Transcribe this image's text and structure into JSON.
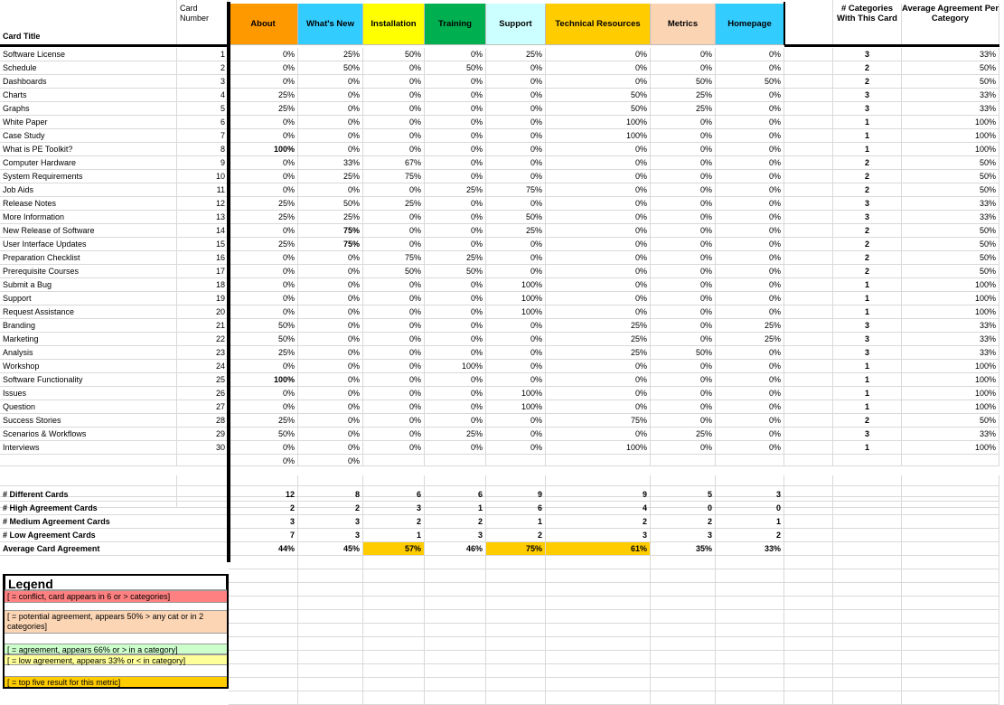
{
  "header": {
    "card_number": "Card\nNumber",
    "card_title": "Card Title",
    "categories": [
      {
        "label": "About",
        "color": "#ff9900"
      },
      {
        "label": "What's New",
        "color": "#33ccff"
      },
      {
        "label": "Installation",
        "color": "#ffff00"
      },
      {
        "label": "Training",
        "color": "#00b050"
      },
      {
        "label": "Support",
        "color": "#ccffff"
      },
      {
        "label": "Technical Resources",
        "color": "#ffcc00"
      },
      {
        "label": "Metrics",
        "color": "#fbd4b4"
      },
      {
        "label": "Homepage",
        "color": "#33ccff"
      }
    ],
    "num_categories": "# Categories With This Card",
    "avg_agreement": "Average Agreement Per Category"
  },
  "rows": [
    {
      "title": "Software License",
      "num": "1",
      "vals": [
        "0%",
        "25%",
        "50%",
        "0%",
        "25%",
        "0%",
        "0%",
        "0%"
      ],
      "cats": "3",
      "avg": "33%"
    },
    {
      "title": "Schedule",
      "num": "2",
      "vals": [
        "0%",
        "50%",
        "0%",
        "50%",
        "0%",
        "0%",
        "0%",
        "0%"
      ],
      "cats": "2",
      "avg": "50%"
    },
    {
      "title": "Dashboards",
      "num": "3",
      "vals": [
        "0%",
        "0%",
        "0%",
        "0%",
        "0%",
        "0%",
        "50%",
        "50%"
      ],
      "cats": "2",
      "avg": "50%"
    },
    {
      "title": "Charts",
      "num": "4",
      "vals": [
        "25%",
        "0%",
        "0%",
        "0%",
        "0%",
        "50%",
        "25%",
        "0%"
      ],
      "cats": "3",
      "avg": "33%"
    },
    {
      "title": "Graphs",
      "num": "5",
      "vals": [
        "25%",
        "0%",
        "0%",
        "0%",
        "0%",
        "50%",
        "25%",
        "0%"
      ],
      "cats": "3",
      "avg": "33%"
    },
    {
      "title": "White Paper",
      "num": "6",
      "vals": [
        "0%",
        "0%",
        "0%",
        "0%",
        "0%",
        "100%",
        "0%",
        "0%"
      ],
      "cats": "1",
      "avg": "100%"
    },
    {
      "title": "Case Study",
      "num": "7",
      "vals": [
        "0%",
        "0%",
        "0%",
        "0%",
        "0%",
        "100%",
        "0%",
        "0%"
      ],
      "cats": "1",
      "avg": "100%"
    },
    {
      "title": "What is PE Toolkit?",
      "num": "8",
      "vals": [
        "100%",
        "0%",
        "0%",
        "0%",
        "0%",
        "0%",
        "0%",
        "0%"
      ],
      "cats": "1",
      "avg": "100%"
    },
    {
      "title": "Computer Hardware",
      "num": "9",
      "vals": [
        "0%",
        "33%",
        "67%",
        "0%",
        "0%",
        "0%",
        "0%",
        "0%"
      ],
      "cats": "2",
      "avg": "50%"
    },
    {
      "title": "System Requirements",
      "num": "10",
      "vals": [
        "0%",
        "25%",
        "75%",
        "0%",
        "0%",
        "0%",
        "0%",
        "0%"
      ],
      "cats": "2",
      "avg": "50%"
    },
    {
      "title": "Job Aids",
      "num": "11",
      "vals": [
        "0%",
        "0%",
        "0%",
        "25%",
        "75%",
        "0%",
        "0%",
        "0%"
      ],
      "cats": "2",
      "avg": "50%"
    },
    {
      "title": "Release Notes",
      "num": "12",
      "vals": [
        "25%",
        "50%",
        "25%",
        "0%",
        "0%",
        "0%",
        "0%",
        "0%"
      ],
      "cats": "3",
      "avg": "33%"
    },
    {
      "title": "More Information",
      "num": "13",
      "vals": [
        "25%",
        "25%",
        "0%",
        "0%",
        "50%",
        "0%",
        "0%",
        "0%"
      ],
      "cats": "3",
      "avg": "33%"
    },
    {
      "title": "New Release of Software",
      "num": "14",
      "vals": [
        "0%",
        "75%",
        "0%",
        "0%",
        "25%",
        "0%",
        "0%",
        "0%"
      ],
      "cats": "2",
      "avg": "50%"
    },
    {
      "title": "User Interface Updates",
      "num": "15",
      "vals": [
        "25%",
        "75%",
        "0%",
        "0%",
        "0%",
        "0%",
        "0%",
        "0%"
      ],
      "cats": "2",
      "avg": "50%"
    },
    {
      "title": "Preparation Checklist",
      "num": "16",
      "vals": [
        "0%",
        "0%",
        "75%",
        "25%",
        "0%",
        "0%",
        "0%",
        "0%"
      ],
      "cats": "2",
      "avg": "50%"
    },
    {
      "title": "Prerequisite Courses",
      "num": "17",
      "vals": [
        "0%",
        "0%",
        "50%",
        "50%",
        "0%",
        "0%",
        "0%",
        "0%"
      ],
      "cats": "2",
      "avg": "50%"
    },
    {
      "title": "Submit a Bug",
      "num": "18",
      "vals": [
        "0%",
        "0%",
        "0%",
        "0%",
        "100%",
        "0%",
        "0%",
        "0%"
      ],
      "cats": "1",
      "avg": "100%"
    },
    {
      "title": "Support",
      "num": "19",
      "vals": [
        "0%",
        "0%",
        "0%",
        "0%",
        "100%",
        "0%",
        "0%",
        "0%"
      ],
      "cats": "1",
      "avg": "100%"
    },
    {
      "title": "Request Assistance",
      "num": "20",
      "vals": [
        "0%",
        "0%",
        "0%",
        "0%",
        "100%",
        "0%",
        "0%",
        "0%"
      ],
      "cats": "1",
      "avg": "100%"
    },
    {
      "title": "Branding",
      "num": "21",
      "vals": [
        "50%",
        "0%",
        "0%",
        "0%",
        "0%",
        "25%",
        "0%",
        "25%"
      ],
      "cats": "3",
      "avg": "33%"
    },
    {
      "title": "Marketing",
      "num": "22",
      "vals": [
        "50%",
        "0%",
        "0%",
        "0%",
        "0%",
        "25%",
        "0%",
        "25%"
      ],
      "cats": "3",
      "avg": "33%"
    },
    {
      "title": "Analysis",
      "num": "23",
      "vals": [
        "25%",
        "0%",
        "0%",
        "0%",
        "0%",
        "25%",
        "50%",
        "0%"
      ],
      "cats": "3",
      "avg": "33%"
    },
    {
      "title": "Workshop",
      "num": "24",
      "vals": [
        "0%",
        "0%",
        "0%",
        "100%",
        "0%",
        "0%",
        "0%",
        "0%"
      ],
      "cats": "1",
      "avg": "100%"
    },
    {
      "title": "Software Functionality",
      "num": "25",
      "vals": [
        "100%",
        "0%",
        "0%",
        "0%",
        "0%",
        "0%",
        "0%",
        "0%"
      ],
      "cats": "1",
      "avg": "100%"
    },
    {
      "title": "Issues",
      "num": "26",
      "vals": [
        "0%",
        "0%",
        "0%",
        "0%",
        "100%",
        "0%",
        "0%",
        "0%"
      ],
      "cats": "1",
      "avg": "100%"
    },
    {
      "title": "Question",
      "num": "27",
      "vals": [
        "0%",
        "0%",
        "0%",
        "0%",
        "100%",
        "0%",
        "0%",
        "0%"
      ],
      "cats": "1",
      "avg": "100%"
    },
    {
      "title": "Success Stories",
      "num": "28",
      "vals": [
        "25%",
        "0%",
        "0%",
        "0%",
        "0%",
        "75%",
        "0%",
        "0%"
      ],
      "cats": "2",
      "avg": "50%"
    },
    {
      "title": "Scenarios & Workflows",
      "num": "29",
      "vals": [
        "50%",
        "0%",
        "0%",
        "25%",
        "0%",
        "0%",
        "25%",
        "0%"
      ],
      "cats": "3",
      "avg": "33%"
    },
    {
      "title": "Interviews",
      "num": "30",
      "vals": [
        "0%",
        "0%",
        "0%",
        "0%",
        "0%",
        "100%",
        "0%",
        "0%"
      ],
      "cats": "1",
      "avg": "100%"
    }
  ],
  "extra_row": [
    "0%",
    "0%"
  ],
  "summary": [
    {
      "label": "# Different Cards",
      "vals": [
        "12",
        "8",
        "6",
        "6",
        "9",
        "9",
        "5",
        "3"
      ]
    },
    {
      "label": "# High Agreement Cards",
      "vals": [
        "2",
        "2",
        "3",
        "1",
        "6",
        "4",
        "0",
        "0"
      ]
    },
    {
      "label": "# Medium Agreement Cards",
      "vals": [
        "3",
        "3",
        "2",
        "2",
        "1",
        "2",
        "2",
        "1"
      ]
    },
    {
      "label": "# Low Agreement Cards",
      "vals": [
        "7",
        "3",
        "1",
        "3",
        "2",
        "3",
        "3",
        "2"
      ]
    },
    {
      "label": "Average Card Agreement",
      "vals": [
        "44%",
        "45%",
        "57%",
        "46%",
        "75%",
        "61%",
        "35%",
        "33%"
      ],
      "highlight": [
        false,
        false,
        true,
        false,
        true,
        true,
        false,
        false
      ]
    }
  ],
  "highlight_color": "#ffcc00",
  "legend": {
    "title": "Legend",
    "items": [
      {
        "text": "[ = conflict, card appears in 6 or > categories]",
        "color": "#ff8080"
      },
      {
        "text": "[ = potential agreement, appears 50% > any cat or in 2 categories]",
        "color": "#fcd5b4"
      },
      {
        "text": "[ = agreement, appears  66% or > in a category]",
        "color": "#ccffcc"
      },
      {
        "text": "[ = low agreement, appears 33% or < in category]",
        "color": "#ffff99"
      },
      {
        "text": "[ = top five result for this metric]",
        "color": "#ffcc00"
      }
    ]
  }
}
